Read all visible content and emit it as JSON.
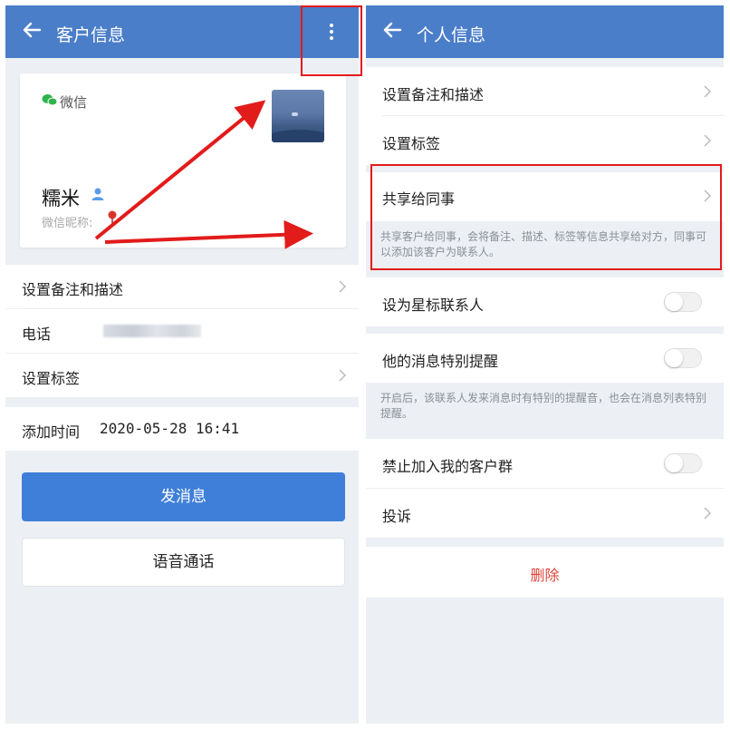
{
  "left": {
    "header": {
      "title": "客户信息",
      "back_icon": "arrow-left-icon",
      "more_icon": "more-vertical-icon"
    },
    "profile": {
      "source_label": "微信",
      "source_icon": "wechat-icon",
      "name": "糯米",
      "nickname_label": "微信昵称:"
    },
    "rows": {
      "remark": "设置备注和描述",
      "phone_label": "电话",
      "tags": "设置标签"
    },
    "added": {
      "label": "添加时间",
      "value": "2020-05-28 16:41"
    },
    "buttons": {
      "send": "发消息",
      "call": "语音通话"
    }
  },
  "right": {
    "header": {
      "title": "个人信息",
      "back_icon": "arrow-left-icon"
    },
    "rows": {
      "remark": "设置备注和描述",
      "tags": "设置标签",
      "share": "共享给同事",
      "share_note": "共享客户给同事，会将备注、描述、标签等信息共享给对方，同事可以添加该客户为联系人。",
      "star": "设为星标联系人",
      "alert": "他的消息特别提醒",
      "alert_note": "开启后，该联系人发来消息时有特别的提醒音，也会在消息列表特别提醒。",
      "block_group": "禁止加入我的客户群",
      "complain": "投诉",
      "delete": "删除"
    },
    "toggles": {
      "star": false,
      "alert": false,
      "block_group": false
    }
  },
  "colors": {
    "header": "#4b7ec9",
    "primary_button": "#3f7fd9",
    "delete": "#e0453c",
    "annotation": "#e21b1b",
    "page_bg": "#eceff3"
  }
}
